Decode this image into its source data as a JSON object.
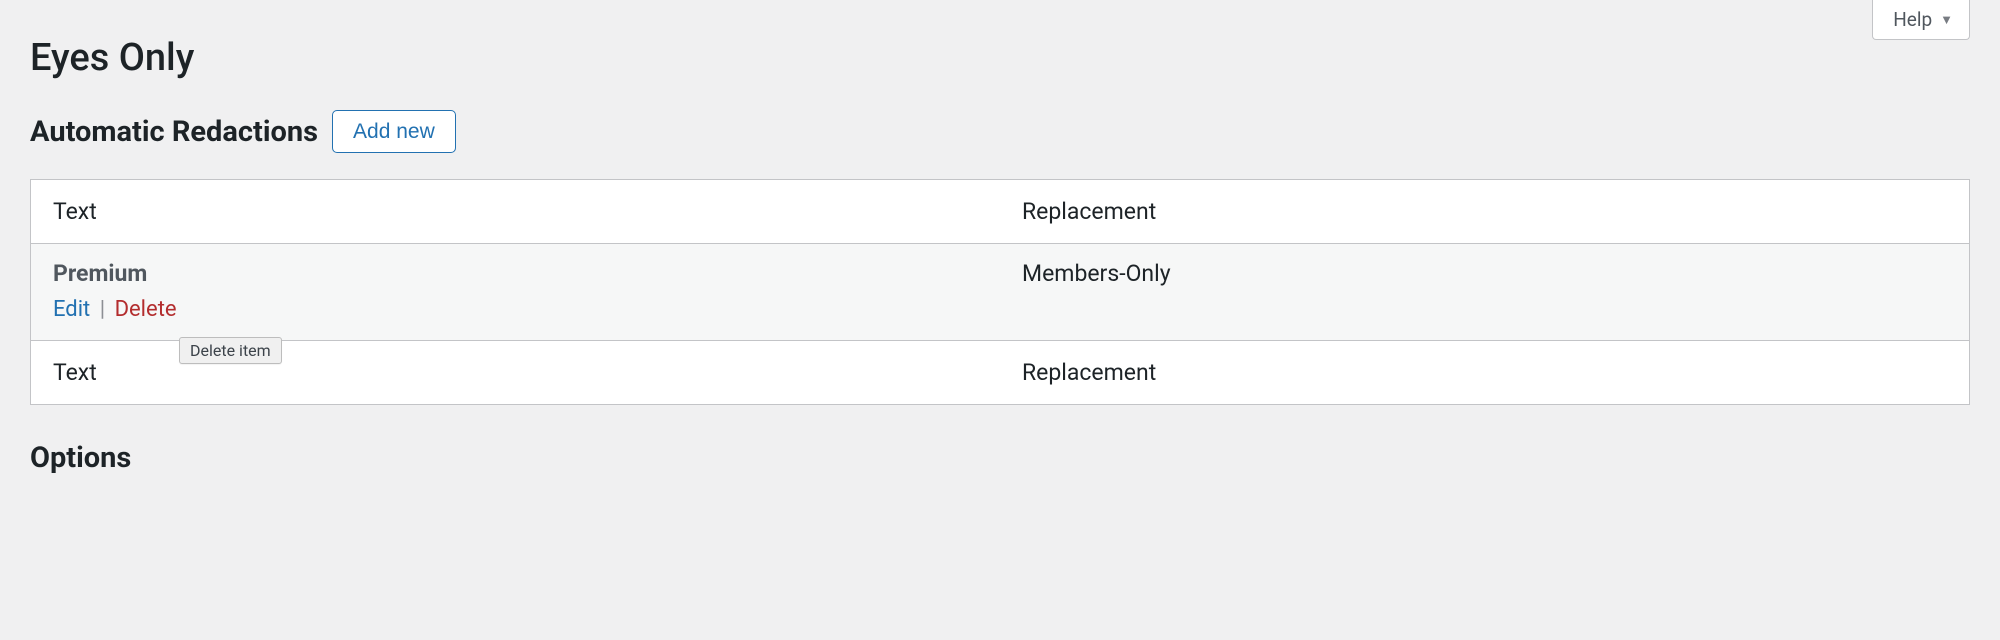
{
  "help": {
    "label": "Help"
  },
  "page": {
    "title": "Eyes Only"
  },
  "redactions": {
    "heading": "Automatic Redactions",
    "add_new": "Add new",
    "columns": {
      "text": "Text",
      "replacement": "Replacement"
    },
    "rows": [
      {
        "text": "Premium",
        "replacement": "Members-Only",
        "actions": {
          "edit": "Edit",
          "sep": "|",
          "delete": "Delete"
        },
        "tooltip": "Delete item"
      }
    ]
  },
  "options": {
    "heading": "Options"
  }
}
